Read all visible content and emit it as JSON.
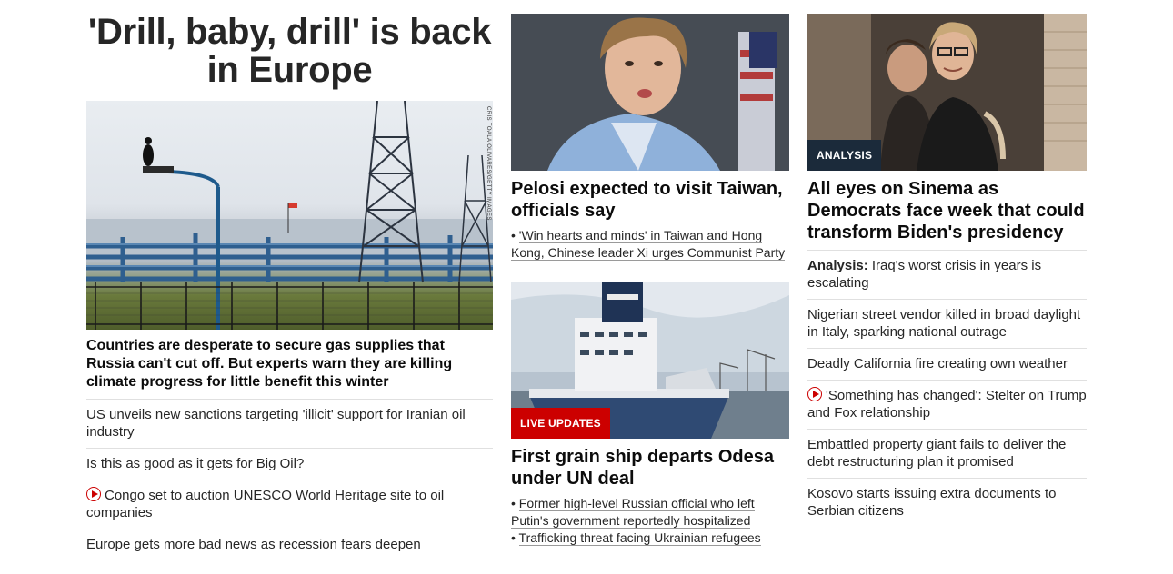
{
  "col1": {
    "title": "'Drill, baby, drill' is back in Europe",
    "image_credit": "CRIS TOALA OLIVARES/GETTY IMAGES",
    "lead_headline": "Countries are desperate to secure gas supplies that Russia can't cut off. But experts warn they are killing climate progress for little benefit this winter",
    "items": [
      {
        "text": "US unveils new sanctions targeting 'illicit' support for Iranian oil industry"
      },
      {
        "text": "Is this as good as it gets for Big Oil?"
      },
      {
        "text": "Congo set to auction UNESCO World Heritage site to oil companies",
        "icon": "play-icon"
      },
      {
        "text": "Europe gets more bad news as recession fears deepen"
      }
    ]
  },
  "col2": {
    "story1": {
      "title": "Pelosi expected to visit Taiwan, officials say",
      "links": [
        "'Win hearts and minds' in Taiwan and Hong Kong, Chinese leader Xi urges Communist Party"
      ]
    },
    "story2": {
      "label": "LIVE UPDATES",
      "title": "First grain ship departs Odesa under UN deal",
      "links": [
        "Former high-level Russian official who left Putin's government reportedly hospitalized",
        "Trafficking threat facing Ukrainian refugees"
      ]
    }
  },
  "col3": {
    "label": "ANALYSIS",
    "title": "All eyes on Sinema as Democrats face week that could transform Biden's presidency",
    "items": [
      {
        "kicker": "Analysis:",
        "text": "Iraq's worst crisis in years is escalating"
      },
      {
        "text": "Nigerian street vendor killed in broad daylight in Italy, sparking national outrage"
      },
      {
        "text": "Deadly California fire creating own weather"
      },
      {
        "text": "'Something has changed': Stelter on Trump and Fox relationship",
        "icon": "play-icon"
      },
      {
        "text": "Embattled property giant fails to deliver the debt restructuring plan it promised"
      },
      {
        "text": "Kosovo starts issuing extra documents to Serbian citizens"
      }
    ]
  },
  "colors": {
    "accent_red": "#cc0000",
    "analysis_navy": "#1b2a3a",
    "divider": "#e0e0e0"
  }
}
